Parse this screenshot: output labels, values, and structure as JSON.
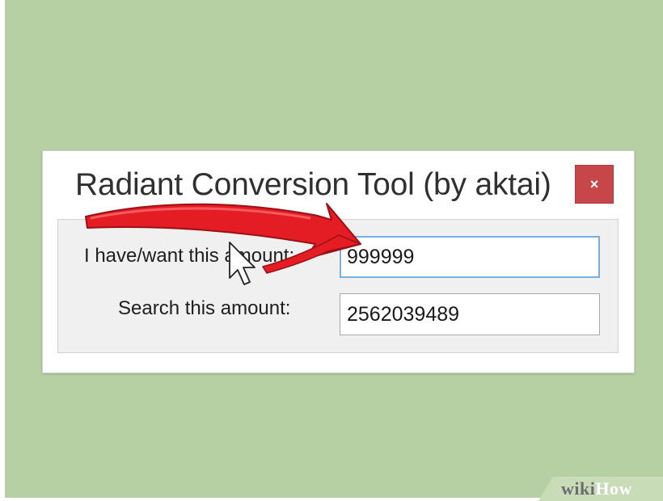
{
  "window": {
    "title": "Radiant Conversion Tool (by aktai)",
    "close_label": "×"
  },
  "fields": {
    "have_want": {
      "label": "I have/want this amount:",
      "value": "999999"
    },
    "search": {
      "label": "Search this amount:",
      "value": "2562039489"
    }
  },
  "watermark": {
    "wiki": "wiki",
    "how": "How"
  },
  "colors": {
    "background": "#b7d0a3",
    "close_button": "#c6464a",
    "arrow": "#e31d23",
    "focus_border": "#7aaee0"
  },
  "annotations": {
    "arrow_icon": "red-curved-arrow-icon",
    "cursor_icon": "mouse-pointer-icon"
  }
}
